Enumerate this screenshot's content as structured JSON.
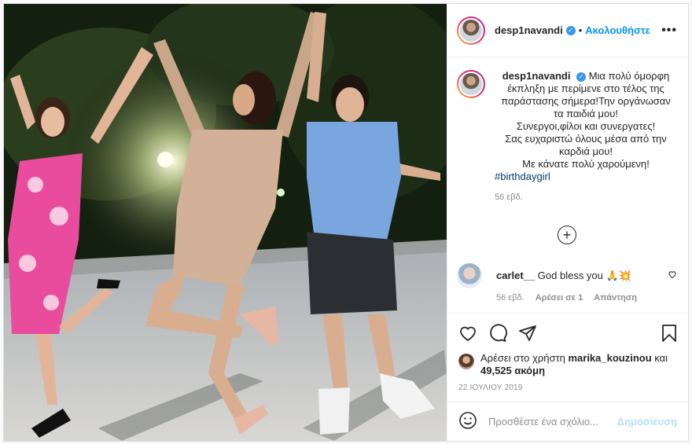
{
  "post": {
    "username": "desp1navandi",
    "follow_label": "Ακολουθήστε",
    "dot": "•",
    "more": "•••",
    "caption": {
      "lines": [
        "Μια πολύ όμορφη",
        "έκπληξη με περίμενε στο τέλος της",
        "παράστασης σήμερα!Την οργάνωσαν",
        "τα παιδιά μου!",
        "Συνεργοι,φίλοι και συνεργατες!",
        "Σας ευχαριστώ όλους μέσα από την",
        "καρδιά μου!",
        "Με κάνατε πολύ χαρούμενη!"
      ],
      "hashtag": "#birthdaygirl",
      "time": "56 εβδ."
    },
    "plus": "+",
    "comment": {
      "username": "carlet__",
      "text": "God bless you 🙏💥",
      "time": "56 εβδ.",
      "likes": "Αρέσει σε 1",
      "reply": "Απάντηση"
    },
    "liked_by": {
      "prefix": "Αρέσει στο χρήστη",
      "user": "marika_kouzinou",
      "and": "και",
      "count": "49,525 ακόμη"
    },
    "date": "22 ΙΟΥΛΙΟΥ 2019",
    "add_comment_placeholder": "Προσθέστε ένα σχόλιο...",
    "publish_label": "Δημοσίευση"
  },
  "icons": [
    "heart-icon",
    "comment-icon",
    "share-icon",
    "bookmark-icon",
    "emoji-icon",
    "verified-icon",
    "plus-circle-icon"
  ]
}
